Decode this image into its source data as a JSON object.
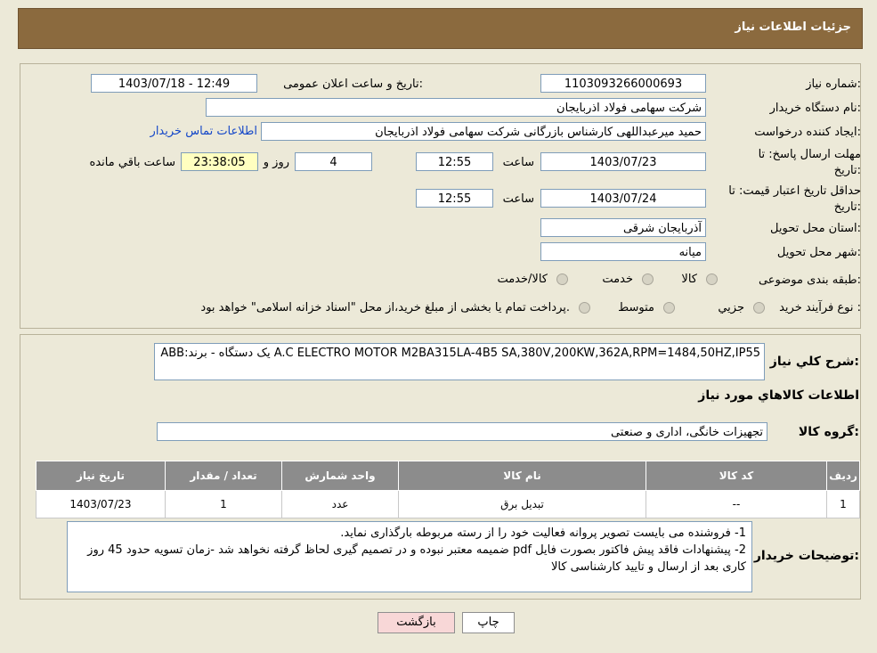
{
  "page_title": "جزئیات اطلاعات نیاز",
  "fields": {
    "need_number_label": "شماره نیاز:",
    "need_number": "1103093266000693",
    "announce_label": "تاریخ و ساعت اعلان عمومی:",
    "announce_value": "1403/07/18 - 12:49",
    "buyer_org_label": "نام دستگاه خریدار:",
    "buyer_org": "شرکت سهامی فولاد اذربایجان",
    "creator_label": "ایجاد کننده درخواست:",
    "creator": "حمید میرعبداللهی کارشناس بازرگانی شرکت سهامی فولاد اذربایجان",
    "contact_link": "اطلاعات تماس خریدار",
    "deadline_label_1": "مهلت ارسال پاسخ: تا",
    "deadline_label_2": "تاریخ:",
    "deadline_date": "1403/07/23",
    "time_label": "ساعت",
    "deadline_time": "12:55",
    "days_value": "4",
    "days_label": "روز و",
    "remaining_time": "23:38:05",
    "remaining_label": "ساعت باقي مانده",
    "validity_label_1": "حداقل تاریخ اعتبار قیمت: تا",
    "validity_label_2": "تاریخ:",
    "validity_date": "1403/07/24",
    "validity_time": "12:55",
    "province_label": "استان محل تحویل:",
    "province": "آذربایجان شرقی",
    "city_label": "شهر محل تحویل:",
    "city": "میانه",
    "category_label": "طبقه بندی موضوعی:",
    "category_options": [
      "کالا",
      "خدمت",
      "کالا/خدمت"
    ],
    "process_label": "نوع فرآیند خرید :",
    "process_options": [
      "جزيي",
      "متوسط"
    ],
    "process_note": "پرداخت تمام یا بخشی از مبلغ خرید،از محل \"اسناد خزانه اسلامی\" خواهد بود."
  },
  "description": {
    "label": "شرح کلي نیاز:",
    "text": "A.C ELECTRO MOTOR M2BA315LA-4B5 SA,380V,200KW,362A,RPM=1484,50HZ,IP55   یک دستگاه - برند:ABB"
  },
  "goods_info_title": "اطلاعات کالاهاي مورد نیاز",
  "goods_group_label": "گروه کالا:",
  "goods_group": "تجهیزات خانگی، اداری و صنعتی",
  "table": {
    "headers": [
      "ردیف",
      "کد کالا",
      "نام کالا",
      "واحد شمارش",
      "تعداد / مقدار",
      "تاریخ نیاز"
    ],
    "rows": [
      [
        "1",
        "--",
        "تبدیل برق",
        "عدد",
        "1",
        "1403/07/23"
      ]
    ]
  },
  "buyer_notes": {
    "label": "توضیحات خریدار:",
    "line1": "1- فروشنده می بایست تصویر پروانه فعالیت خود را از رسته مربوطه بارگذاری نماید.",
    "line2": "2- پیشنهادات فاقد پیش فاکتور بصورت فایل pdf  ضمیمه معتبر نبوده و در تصمیم گیری لحاظ گرفته نخواهد شد -زمان تسویه حدود 45  روز کاری بعد از ارسال و تایید کارشناسی کالا"
  },
  "buttons": {
    "print": "چاپ",
    "back": "بازگشت"
  },
  "colors": {
    "header_bg": "#8b6a3e",
    "table_header_bg": "#8c8c8c",
    "back_button_bg": "#f8d7d7",
    "link": "#1447c8"
  }
}
